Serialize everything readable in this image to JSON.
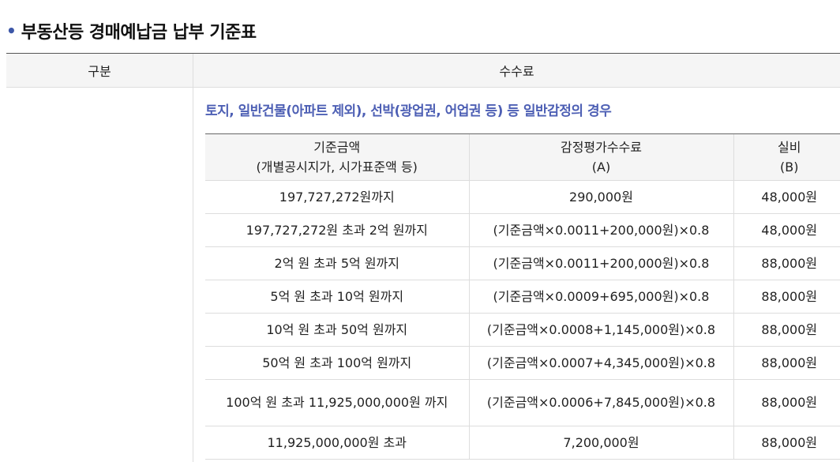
{
  "page": {
    "bullet": "•",
    "title": "부동산등 경매예납금 납부 기준표"
  },
  "outer_table": {
    "col_category": "구분",
    "col_fee": "수수료"
  },
  "section": {
    "title": "토지, 일반건물(아파트 제외), 선박(광업권, 어업권 등) 등 일반감정의 경우"
  },
  "fee_table": {
    "headers": [
      {
        "line1": "기준금액",
        "line2": "(개별공시지가, 시가표준액 등)"
      },
      {
        "line1": "감정평가수수료",
        "line2": "(A)"
      },
      {
        "line1": "실비",
        "line2": "(B)"
      }
    ],
    "rows": [
      {
        "range": "197,727,272원까지",
        "fee": "290,000원",
        "cost": "48,000원"
      },
      {
        "range": "197,727,272원 초과 2억 원까지",
        "fee": "(기준금액×0.0011+200,000원)×0.8",
        "cost": "48,000원"
      },
      {
        "range": "2억 원 초과 5억 원까지",
        "fee": "(기준금액×0.0011+200,000원)×0.8",
        "cost": "88,000원"
      },
      {
        "range": "5억 원 초과 10억 원까지",
        "fee": "(기준금액×0.0009+695,000원)×0.8",
        "cost": "88,000원"
      },
      {
        "range": "10억 원 초과 50억 원까지",
        "fee": "(기준금액×0.0008+1,145,000원)×0.8",
        "cost": "88,000원"
      },
      {
        "range": "50억 원 초과 100억 원까지",
        "fee": "(기준금액×0.0007+4,345,000원)×0.8",
        "cost": "88,000원"
      },
      {
        "range": "100억 원 초과 11,925,000,000원 까지",
        "fee": "(기준금액×0.0006+7,845,000원)×0.8",
        "cost": "88,000원"
      },
      {
        "range": "11,925,000,000원 초과",
        "fee": "7,200,000원",
        "cost": "88,000원"
      }
    ]
  }
}
